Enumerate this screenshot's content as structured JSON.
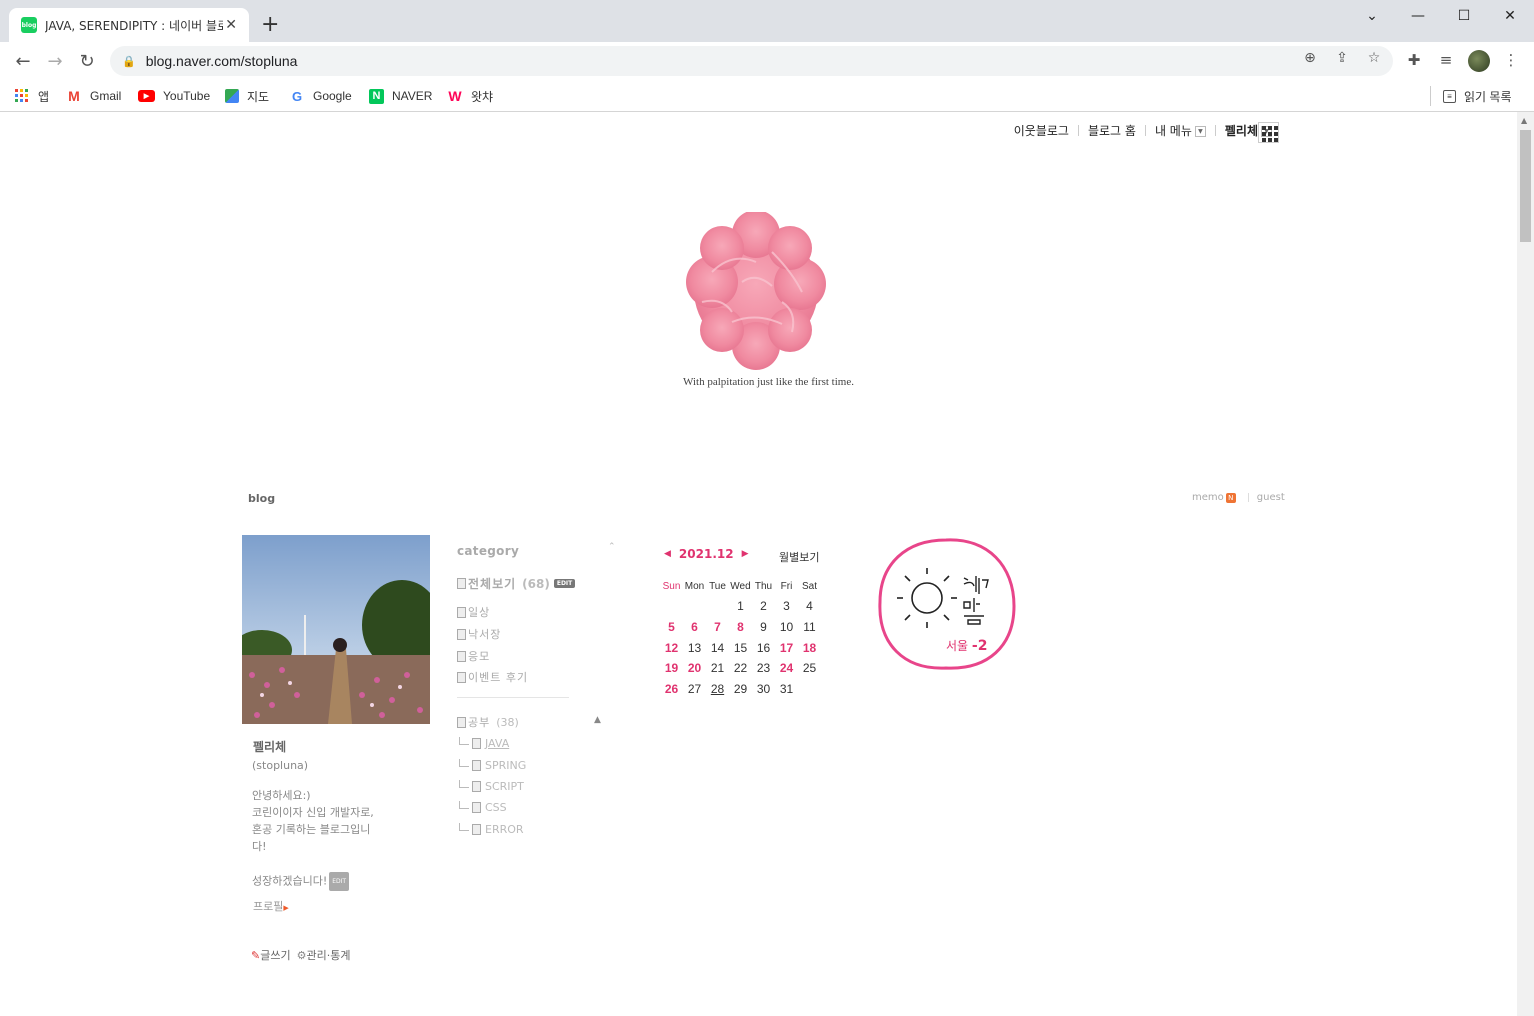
{
  "browser": {
    "tab_title": "JAVA, SERENDIPITY : 네이버 블로그",
    "favicon_text": "blog",
    "url": "blog.naver.com/stopluna",
    "bookmarks": [
      {
        "label": "앱",
        "icon": "apps-grid-icon"
      },
      {
        "label": "Gmail",
        "icon": "gmail-icon"
      },
      {
        "label": "YouTube",
        "icon": "youtube-icon"
      },
      {
        "label": "지도",
        "icon": "maps-icon"
      },
      {
        "label": "Google",
        "icon": "google-icon"
      },
      {
        "label": "NAVER",
        "icon": "naver-icon"
      },
      {
        "label": "왓챠",
        "icon": "watcha-icon"
      }
    ],
    "reading_list": "읽기 목록"
  },
  "blog": {
    "top_menu": {
      "neighbor_blog": "이웃블로그",
      "blog_home": "블로그 홈",
      "my_menu": "내 메뉴",
      "user_name": "펠리체"
    },
    "tagline": "With palpitation just like the first time.",
    "blog_label": "blog",
    "memo": "memo",
    "memo_badge": "N",
    "guest": "guest",
    "profile": {
      "nickname": "펠리체",
      "id": "(stopluna)",
      "intro": "안녕하세요:)\n코린이이자 신입 개발자로,\n혼공 기록하는 블로그입니\n다!\n\n성장하겠습니다!",
      "edit_tag": "EDIT",
      "profile_link": "프로필",
      "write": "글쓰기",
      "manage": "관리·통계"
    },
    "category": {
      "title": "category",
      "all": {
        "label": "전체보기",
        "count": "(68)",
        "edit": "EDIT"
      },
      "items": [
        "일상",
        "낙서장",
        "응모",
        "이벤트 후기"
      ],
      "study": {
        "label": "공부",
        "count": "(38)"
      },
      "sub_items": [
        "JAVA",
        "SPRING",
        "SCRIPT",
        "CSS",
        "ERROR"
      ]
    },
    "calendar": {
      "year_month": "2021.12",
      "monthly_view": "월별보기",
      "weekdays": [
        "Sun",
        "Mon",
        "Tue",
        "Wed",
        "Thu",
        "Fri",
        "Sat"
      ],
      "weeks": [
        [
          "",
          "",
          "",
          "1",
          "2",
          "3",
          "4"
        ],
        [
          "5",
          "6",
          "7",
          "8",
          "9",
          "10",
          "11"
        ],
        [
          "12",
          "13",
          "14",
          "15",
          "16",
          "17",
          "18"
        ],
        [
          "19",
          "20",
          "21",
          "22",
          "23",
          "24",
          "25"
        ],
        [
          "26",
          "27",
          "28",
          "29",
          "30",
          "31",
          ""
        ]
      ],
      "highlighted": [
        "5",
        "6",
        "7",
        "8",
        "12",
        "17",
        "18",
        "19",
        "20",
        "24",
        "26"
      ],
      "today": "28",
      "accent_color": "#e0336f"
    },
    "weather": {
      "handwriting": "해가 맑음",
      "city": "서울",
      "temp": "-2",
      "icon": "sun-icon"
    }
  }
}
